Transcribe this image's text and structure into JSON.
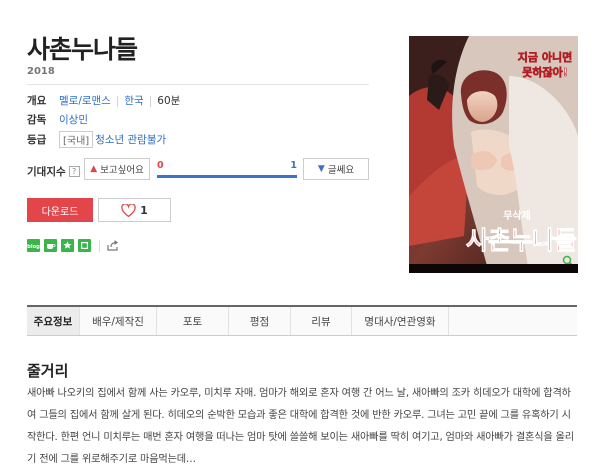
{
  "movie": {
    "title": "사촌누나들",
    "year": "2018",
    "info": {
      "genre_label": "개요",
      "genre": "멜로/로맨스",
      "country": "한국",
      "runtime": "60분",
      "director_label": "감독",
      "director": "이상민",
      "rating_label": "등급",
      "rating_tag": "[국내]",
      "rating": "청소년 관람불가"
    }
  },
  "expectation": {
    "label": "기대지수",
    "help_icon": "question-icon",
    "want_label": "보고싶어요",
    "want_count": "0",
    "not_label": "글쎄요",
    "not_count": "1",
    "want_ratio": 0,
    "colors": {
      "want": "#e04646",
      "not": "#3a73c9"
    }
  },
  "actions": {
    "download_label": "다운로드",
    "like_count": "1",
    "download_color": "#e2454a"
  },
  "social": {
    "icons": [
      "blog-icon",
      "cafe-icon",
      "star-share-icon",
      "square-share-icon",
      "share-icon"
    ],
    "blog_label": "blog"
  },
  "poster": {
    "tagline_1": "지금 아니면",
    "tagline_2": "못하잖아!",
    "badge": "무삭제",
    "title": "사촌누나들"
  },
  "tabs": [
    {
      "label": "주요정보",
      "active": true
    },
    {
      "label": "배우/제작진"
    },
    {
      "label": "포토"
    },
    {
      "label": "평점"
    },
    {
      "label": "리뷰"
    },
    {
      "label": "명대사/연관영화"
    }
  ],
  "synopsis": {
    "heading": "줄거리",
    "text": "새아빠 나오키의 집에서 함께 사는 카오루, 미치루 자매. 엄마가 해외로 혼자 여행 간 어느 날, 새아빠의 조카 히데오가 대학에 합격하여 그들의 집에서 함께 살게 된다. 히데오의 순박한 모습과 좋은 대학에 합격한 것에 반한 카오루. 그녀는 고민 끝에 그를 유혹하기 시작한다. 한편 언니 미치루는 매번 혼자 여행을 떠나는 엄마 탓에 쓸쓸해 보이는 새아빠를 딱히 여기고, 엄마와 새아빠가 결혼식을 올리기 전에 그를 위로해주기로 마음먹는데…"
  }
}
